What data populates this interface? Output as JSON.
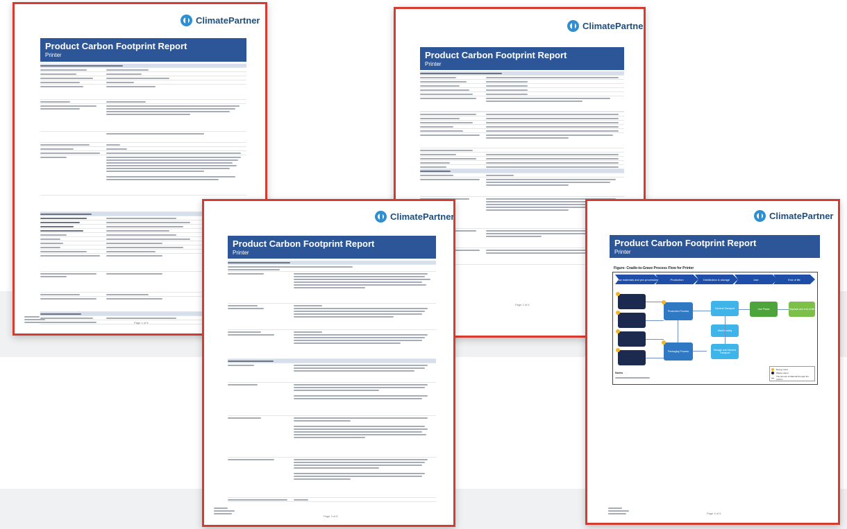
{
  "brand": {
    "name": "ClimatePartner",
    "accent": "#2c5697",
    "frame": "#d63b32"
  },
  "report": {
    "title": "Product Carbon Footprint Report",
    "subtitle": "Printer"
  },
  "pages": [
    {
      "id": "page-1",
      "page_label": "Page 1 of 5"
    },
    {
      "id": "page-2",
      "page_label": "Page 2 of 5"
    },
    {
      "id": "page-3",
      "page_label": "Page 3 of 5"
    },
    {
      "id": "page-4",
      "page_label": "Page 4 of 5"
    }
  ],
  "flow": {
    "title": "Figure: Cradle-to-Grave Process Flow for Printer",
    "stages": [
      "Raw materials and pre-processing",
      "Production",
      "Distribution & storage",
      "Use",
      "End of life"
    ],
    "nodes": {
      "production": "Production Process",
      "packaging": "Packaging Process",
      "general_transport": "General Transport",
      "use_phase": "Use Phase",
      "storage": "Storage and General Transport",
      "warehousing": "Warehousing",
      "eol": "Disposal and end-of-life"
    },
    "legend": [
      "Energy input",
      "Waste output",
      "The amount of Material through the system"
    ],
    "notes_label": "Notes"
  }
}
